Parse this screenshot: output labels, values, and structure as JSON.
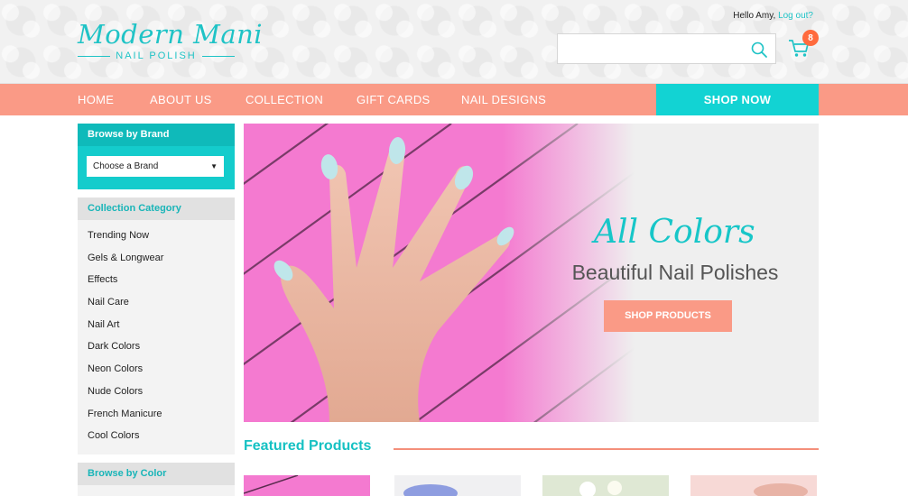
{
  "brand": {
    "name": "Modern Mani",
    "tagline": "NAIL POLISH"
  },
  "user": {
    "greeting": "Hello Amy,",
    "logout": "Log out?"
  },
  "search": {
    "placeholder": ""
  },
  "cart": {
    "count": "8"
  },
  "nav": {
    "items": [
      "HOME",
      "ABOUT US",
      "COLLECTION",
      "GIFT CARDS",
      "NAIL DESIGNS"
    ],
    "cta": "SHOP NOW"
  },
  "sidebar": {
    "brand_title": "Browse by Brand",
    "brand_select": "Choose a Brand",
    "category_title": "Collection Category",
    "categories": [
      "Trending Now",
      "Gels & Longwear",
      "Effects",
      "Nail Care",
      "Nail Art",
      "Dark Colors",
      "Neon Colors",
      "Nude Colors",
      "French Manicure",
      "Cool Colors"
    ],
    "color_title": "Browse by Color"
  },
  "hero": {
    "script": "All Colors",
    "subtitle": "Beautiful Nail Polishes",
    "button": "SHOP PRODUCTS"
  },
  "featured": {
    "title": "Featured Products"
  },
  "colors": {
    "teal": "#12d3d3",
    "coral": "#fa9a86",
    "pink": "#f47ad0",
    "badge": "#ff6a3d"
  },
  "icons": {
    "search": "search-icon",
    "cart": "cart-icon",
    "caret": "chevron-down-icon"
  }
}
